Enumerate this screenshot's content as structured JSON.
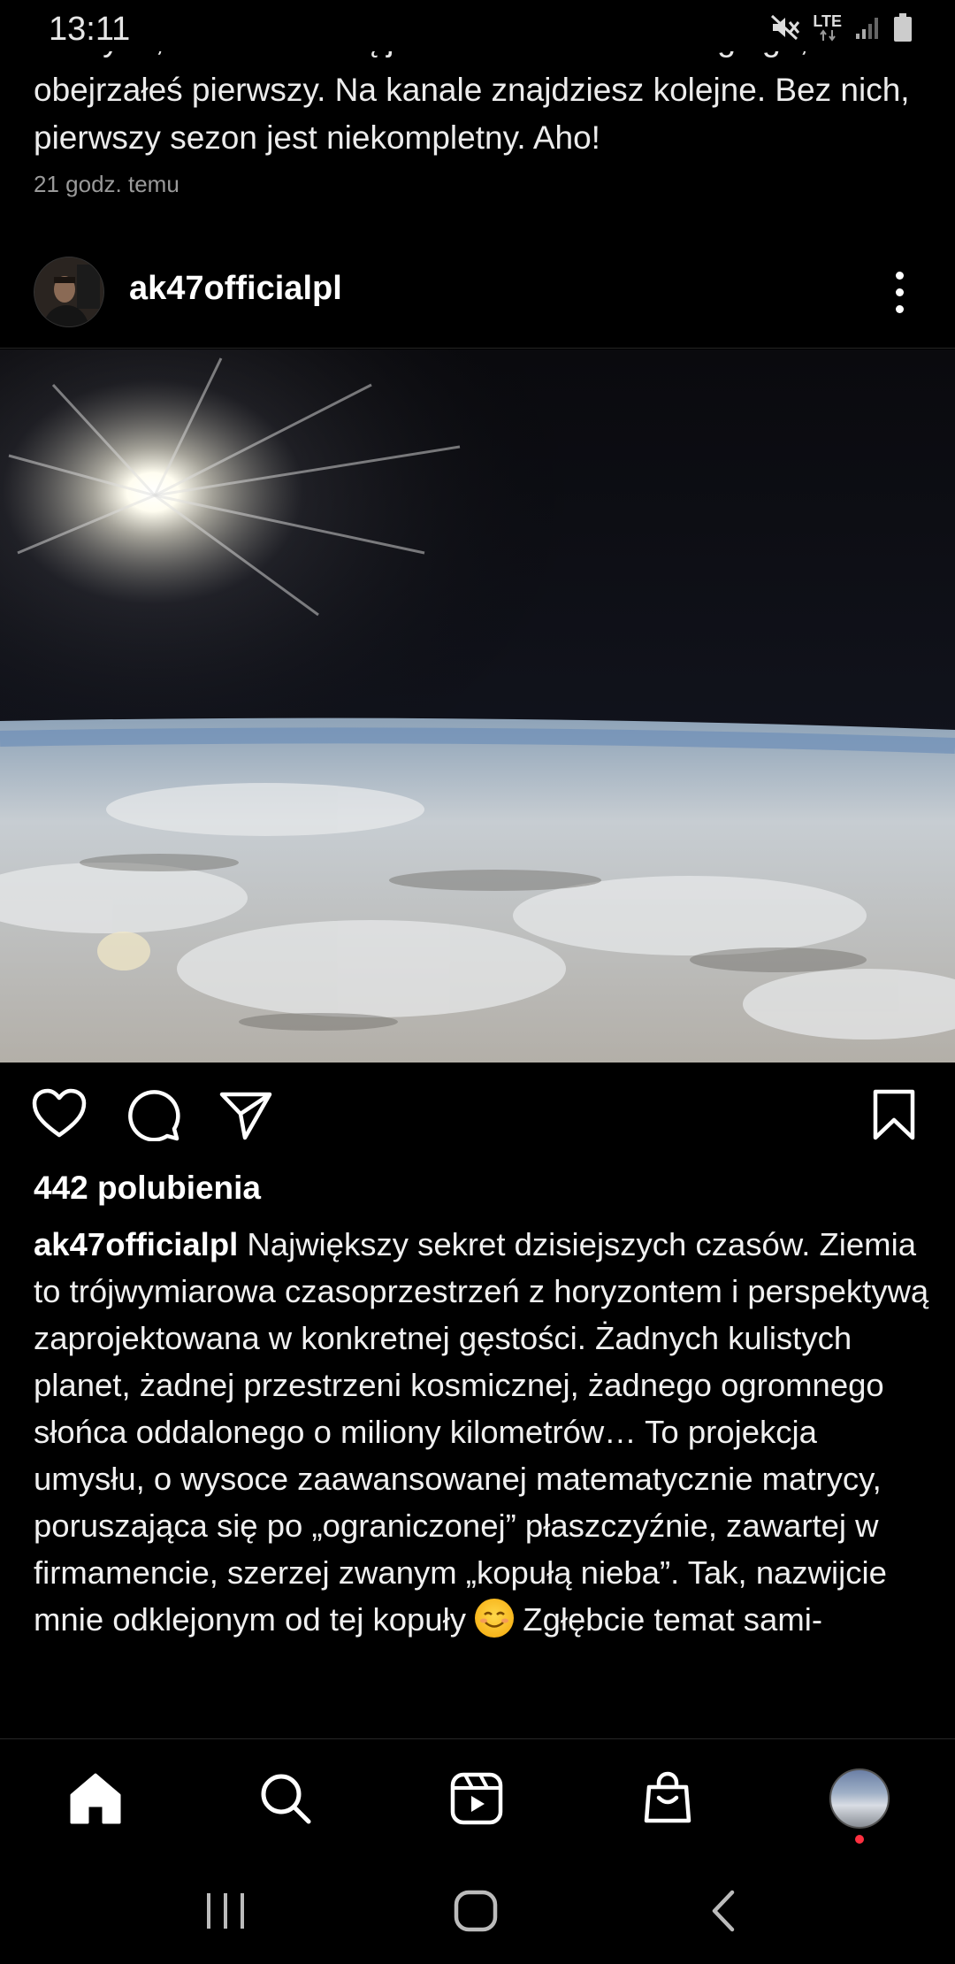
{
  "status_bar": {
    "time": "13:11",
    "network": "LTE"
  },
  "previous_post": {
    "cut_line": "Dla tych, co nie wiedzą jeszcze o istnieniu drugiego, a",
    "text": "obejrzałeś pierwszy. Na kanale znajdziesz kolejne. Bez nich, pierwszy sezon jest niekompletny. Aho!",
    "time_ago": "21 godz. temu"
  },
  "post": {
    "username": "ak47officialpl",
    "likes": "442 polubienia",
    "caption_user": "ak47officialpl",
    "caption_text": "Największy sekret dzisiejszych czasów. Ziemia to trójwymiarowa czasoprzestrzeń z horyzontem i perspektywą zaprojektowana w konkretnej gęstości. Żadnych kulistych planet, żadnej przestrzeni kosmicznej, żadnego ogromnego słońca oddalonego o miliony kilometrów… To projekcja umysłu, o wysoce zaawansowanej matematycznie matrycy, poruszająca się po „ograniczonej” płaszczyźnie, zawartej w firmamencie, szerzej zwanym „kopułą nieba”. Tak, nazwijcie mnie odklejonym od tej kopuły",
    "caption_after_emoji": "Zgłębcie temat sami-",
    "image_icon": "earth-horizon-photo"
  },
  "actions": {
    "icons": [
      "heart-icon",
      "comment-icon",
      "share-icon",
      "bookmark-icon"
    ]
  },
  "bottom_nav": {
    "icons": [
      "home-icon",
      "search-icon",
      "reels-icon",
      "shop-icon",
      "profile-avatar"
    ]
  },
  "system_nav": {
    "icons": [
      "recent-apps-icon",
      "home-button-icon",
      "back-icon"
    ]
  },
  "colors": {
    "background": "#000000",
    "text": "#ffffff",
    "secondary": "#9a9a9a",
    "notification": "#ff3040"
  }
}
